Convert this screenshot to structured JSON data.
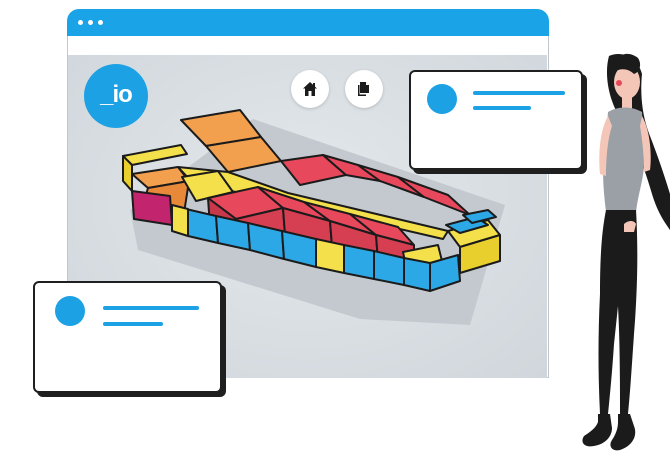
{
  "app": {
    "logo_text": "_io"
  },
  "toolbar": {
    "home_icon": "home-icon",
    "documents_icon": "documents-icon"
  },
  "colors": {
    "accent": "#1ca1e4",
    "orange": "#f2a04d",
    "red": "#e8485c",
    "yellow": "#f4e04a",
    "blue": "#2ca8e6",
    "magenta": "#c2256e"
  },
  "cards": [
    {
      "avatar": "avatar-placeholder",
      "lines": 2
    },
    {
      "avatar": "avatar-placeholder",
      "lines": 2
    }
  ]
}
